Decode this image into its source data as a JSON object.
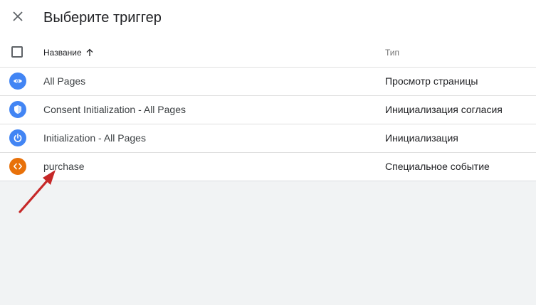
{
  "dialog": {
    "title": "Выберите триггер"
  },
  "table": {
    "headers": {
      "name": "Название",
      "type": "Тип"
    },
    "rows": [
      {
        "name": "All Pages",
        "type": "Просмотр страницы",
        "icon": "eye-icon",
        "color": "#4285f4"
      },
      {
        "name": "Consent Initialization - All Pages",
        "type": "Инициализация согласия",
        "icon": "shield-icon",
        "color": "#4285f4"
      },
      {
        "name": "Initialization - All Pages",
        "type": "Инициализация",
        "icon": "power-icon",
        "color": "#4285f4"
      },
      {
        "name": "purchase",
        "type": "Специальное событие",
        "icon": "code-icon",
        "color": "#e8710a"
      }
    ]
  },
  "annotation": {
    "arrow_color": "#c62828"
  }
}
